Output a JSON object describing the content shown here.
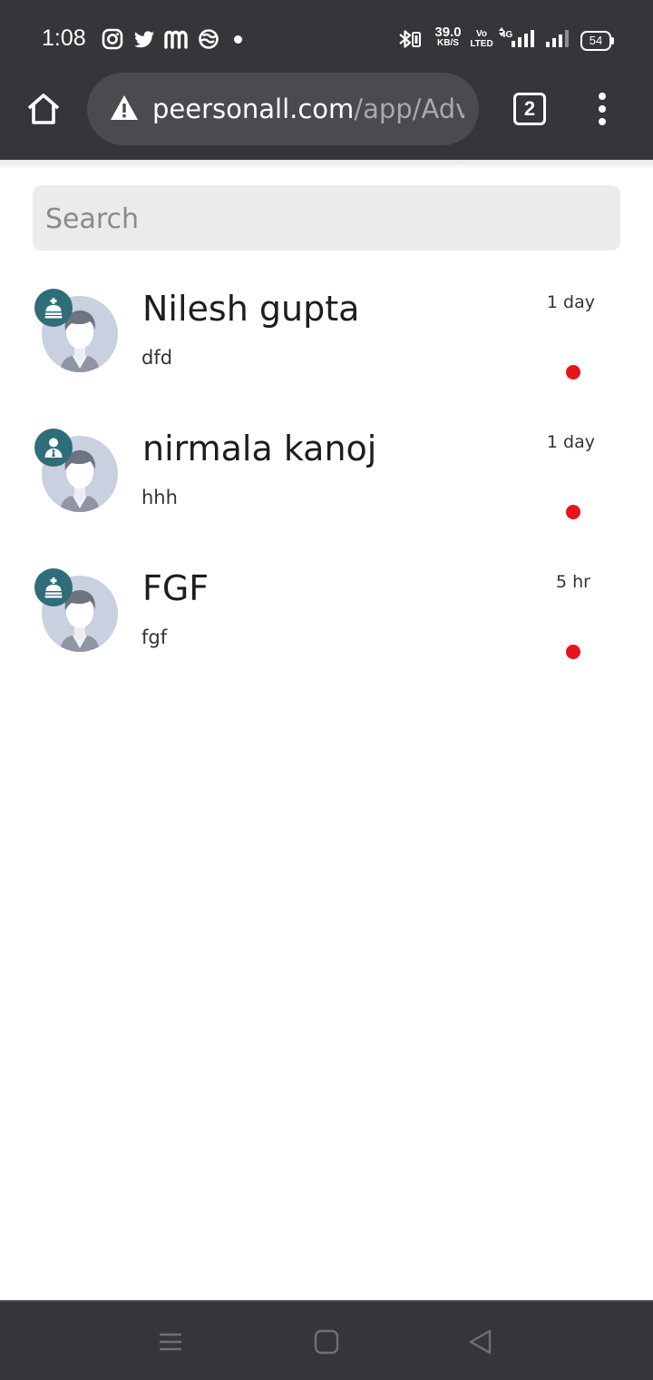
{
  "status_bar": {
    "time": "1:08",
    "notification_icons": [
      "instagram-icon",
      "twitter-icon",
      "m-app-icon",
      "sync-blocked-icon"
    ],
    "net_speed_value": "39.0",
    "net_speed_unit": "KB/S",
    "volte_top": "Vo",
    "volte_bottom": "LTED",
    "network_type": "4G",
    "battery": "54"
  },
  "browser": {
    "url_domain": "peersonall.com",
    "url_path": "/app/Adv",
    "tab_count": "2"
  },
  "search": {
    "placeholder": "Search",
    "value": ""
  },
  "chats": [
    {
      "name": "Nilesh gupta",
      "message": "dfd",
      "time": "1 day",
      "badge_icon": "crown-icon",
      "unread": true
    },
    {
      "name": "nirmala kanoj",
      "message": "hhh",
      "time": "1 day",
      "badge_icon": "user-tie-icon",
      "unread": true
    },
    {
      "name": "FGF",
      "message": "fgf",
      "time": "5 hr",
      "badge_icon": "crown-icon",
      "unread": true
    }
  ],
  "colors": {
    "system_bar": "#35363a",
    "badge": "#2f6e78",
    "unread_dot": "#e8141b",
    "search_bg": "#ebebeb"
  },
  "nav_bar": {
    "buttons": [
      "recents-icon",
      "home-icon",
      "back-icon"
    ]
  }
}
